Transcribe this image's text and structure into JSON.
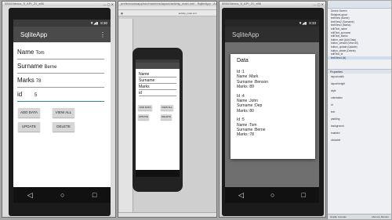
{
  "windows": {
    "left_title": "5554:Nexus_5_API_21_x86",
    "center_title": "preferencesapp/src/main/res/layout/activity_main.xml - SqliteApp - Android Studio",
    "right_title": "5554:Nexus_5_API_21_x86"
  },
  "emulator_left": {
    "time": "8:30",
    "app_title": "SqliteApp",
    "menu_glyph": "⋮",
    "fields": [
      {
        "label": "Name",
        "value": "Tom"
      },
      {
        "label": "Surname",
        "value": "Berne"
      },
      {
        "label": "Marks",
        "value": "78"
      },
      {
        "label": "id",
        "value": "5"
      }
    ],
    "buttons": {
      "add_data": "ADD DATA",
      "view_all": "VIEW ALL",
      "update": "UPDATE",
      "delete": "DELETE"
    },
    "nav": {
      "back": "◁",
      "home": "○",
      "recents": "□"
    }
  },
  "designer_preview": {
    "toolbar_tab": "activity_main.xml",
    "fields": [
      "Name",
      "Surname",
      "Marks",
      "id"
    ],
    "buttons": {
      "add_data": "ADD DATA",
      "view_all": "VIEW ALL",
      "update": "UPDATE",
      "delete": "DELETE"
    }
  },
  "emulator_right": {
    "time": "8:33",
    "app_title": "SqliteApp",
    "dialog": {
      "title": "Data",
      "records": [
        [
          "Id :1",
          "Name :Mark",
          "Surname :Benson",
          "Marks :89"
        ],
        [
          "Id :4",
          "Name :John",
          "Surname :Dep",
          "Marks :80"
        ],
        [
          "Id :5",
          "Name :Tom",
          "Surname :Berne",
          "Marks :78"
        ]
      ]
    },
    "nav": {
      "back": "◁",
      "home": "○",
      "recents": "□"
    }
  },
  "component_tree": {
    "items": [
      "Device Screen",
      "RelativeLayout",
      "textView (Name)",
      "textView2 (Surname)",
      "textView3 (Marks)",
      "editText_name",
      "editText_surname",
      "editText_Marks",
      "button_add (Add Data)",
      "button_viewAll (View All)",
      "button_update (Update)",
      "button_delete (Delete)",
      "editText_id",
      "textView4 (id)"
    ],
    "props_label": "Properties",
    "prop_rows": [
      "layout:width",
      "layout:height",
      "style",
      "orientation",
      "id",
      "text",
      "padding",
      "background",
      "enabled",
      "clickable"
    ]
  },
  "status_bar": {
    "left": "Gradle Console",
    "right": "Memory Monitor"
  }
}
